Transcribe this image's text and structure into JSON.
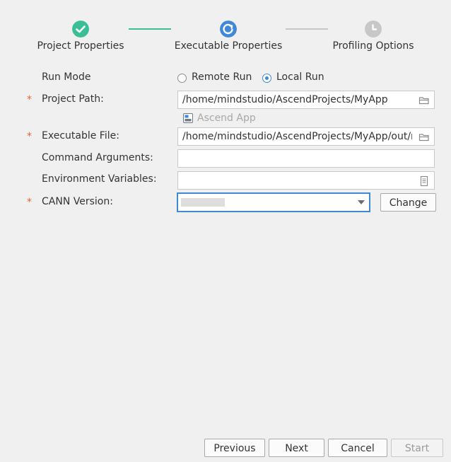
{
  "wizard": {
    "steps": [
      {
        "label": "Project Properties",
        "state": "done",
        "icon": "check-icon",
        "color": "#3bbd95"
      },
      {
        "label": "Executable Properties",
        "state": "active",
        "icon": "refresh-icon",
        "color": "#3f89d8"
      },
      {
        "label": "Profiling Options",
        "state": "pending",
        "icon": "clock-icon",
        "color": "#c7c7c7"
      }
    ],
    "connector_colors": [
      "#3bbd95",
      "#c7c7c7"
    ]
  },
  "form": {
    "run_mode": {
      "label": "Run Mode",
      "options": [
        {
          "label": "Remote Run",
          "checked": false
        },
        {
          "label": "Local Run",
          "checked": true
        }
      ]
    },
    "project_path": {
      "label": "Project Path:",
      "required_mark": "*",
      "value": "/home/mindstudio/AscendProjects/MyApp",
      "icon": "folder-icon",
      "hint": "Ascend App",
      "hint_icon": "ascend-app-icon"
    },
    "executable_file": {
      "label": "Executable File:",
      "required_mark": "*",
      "value": "/home/mindstudio/AscendProjects/MyApp/out/main",
      "icon": "folder-icon"
    },
    "command_arguments": {
      "label": "Command Arguments:",
      "value": ""
    },
    "environment_variables": {
      "label": "Environment Variables:",
      "value": "",
      "icon": "document-icon"
    },
    "cann_version": {
      "label": "CANN Version:",
      "required_mark": "*",
      "value": "",
      "icon": "dropdown-arrow-icon",
      "change_label": "Change"
    }
  },
  "footer": {
    "previous": "Previous",
    "next": "Next",
    "cancel": "Cancel",
    "start": "Start"
  },
  "colors": {
    "accent": "#3f89d8",
    "done": "#3bbd95",
    "pending": "#c7c7c7",
    "required": "#e0663b",
    "background": "#f0f0f0"
  }
}
